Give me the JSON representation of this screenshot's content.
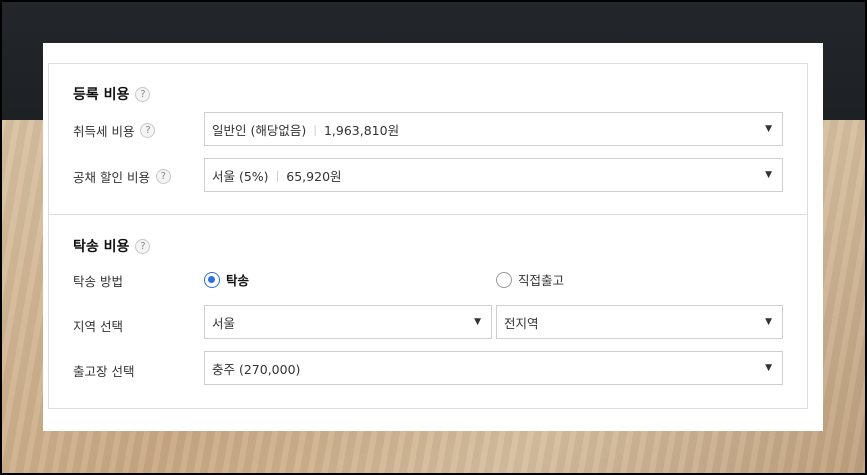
{
  "registration": {
    "title": "등록 비용",
    "help": "?",
    "acquisition_tax": {
      "label": "취득세 비용",
      "help": "?",
      "type": "일반인 (해당없음)",
      "amount": "1,963,810원"
    },
    "bond_discount": {
      "label": "공채 할인 비용",
      "help": "?",
      "region": "서울 (5%)",
      "amount": "65,920원"
    }
  },
  "delivery": {
    "title": "탁송 비용",
    "help": "?",
    "method": {
      "label": "탁송 방법",
      "options": [
        "탁송",
        "직접출고"
      ],
      "selected": "탁송"
    },
    "region": {
      "label": "지역 선택",
      "city": "서울",
      "district": "전지역"
    },
    "warehouse": {
      "label": "출고장 선택",
      "value": "충주 (270,000)"
    }
  },
  "icons": {
    "caret": "▼",
    "help": "question-circle-icon"
  },
  "colors": {
    "accent": "#2f6fe0",
    "border": "#cfcfcf"
  }
}
